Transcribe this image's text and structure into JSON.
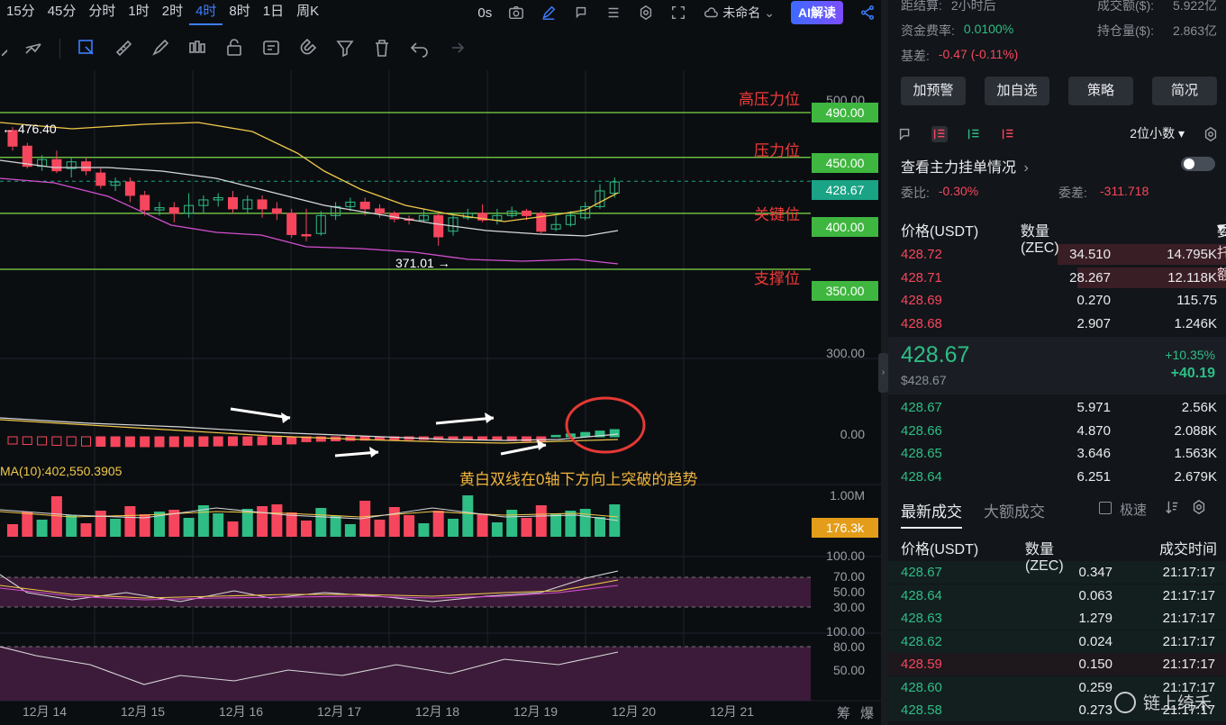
{
  "toolbar": {
    "timeframes": [
      "15分",
      "45分",
      "分时",
      "1时",
      "2时",
      "4时",
      "8时",
      "1日",
      "周K"
    ],
    "active_timeframe": "4时",
    "countdown": "0s",
    "layout_name": "未命名",
    "ai_label": "AI解读"
  },
  "chart": {
    "levels": [
      {
        "name": "高压力位",
        "value": "490.00"
      },
      {
        "name": "压力位",
        "value": "450.00"
      },
      {
        "name": "关键位",
        "value": "400.00"
      },
      {
        "name": "支撑位",
        "value": "350.00"
      }
    ],
    "last_price_tag": "428.67",
    "axis_labels": {
      "p500": "500.00",
      "p300": "300.00",
      "macd_zero": "0.00",
      "vol_max": "1.00M",
      "vol_tag": "176.3k"
    },
    "rsi_axis": [
      "100.00",
      "70.00",
      "50.00",
      "30.00"
    ],
    "kdj_axis": [
      "100.00",
      "80.00",
      "50.00"
    ],
    "high_note": "← 476.40",
    "low_note": "371.01 →",
    "ma_text": "MA(10):402,550.3905",
    "annotation": "黄白双线在0轴下方向上突破的趋势",
    "x_labels": [
      "12月 14",
      "12月 15",
      "12月 16",
      "12月 17",
      "12月 18",
      "12月 19",
      "12月 20",
      "12月 21"
    ],
    "corner_tags": [
      "筹",
      "爆"
    ],
    "colors": {
      "up": "#2ebd85",
      "down": "#f6465d",
      "level_line": "#7ddc4a",
      "ma_yellow": "#f0c84a",
      "ma_white": "#d8d8d8",
      "ma_pink": "#d44fd0"
    }
  },
  "panel": {
    "settle_label": "距结算:",
    "settle_value": "2小时后",
    "turnover_label": "成交额($):",
    "turnover_value": "5.922亿",
    "funding_label": "资金费率:",
    "funding_value": "0.0100%",
    "oi_label": "持仓量($):",
    "oi_value": "2.863亿",
    "basis_label": "基差:",
    "basis_value": "-0.47 (-0.11%)",
    "buttons": [
      "加预警",
      "加自选",
      "策略",
      "简况"
    ],
    "decimals": "2位小数",
    "main_orders": "查看主力挂单情况",
    "ratio_label": "委比:",
    "ratio_value": "-0.30%",
    "diff_label": "委差:",
    "diff_value": "-311.718",
    "ob_headers": [
      "价格(USDT)",
      "数量 (ZEC)",
      "委托额"
    ],
    "asks": [
      {
        "price": "428.72",
        "qty": "34.510",
        "amt": "14.795K",
        "depth": 0.5
      },
      {
        "price": "428.71",
        "qty": "28.267",
        "amt": "12.118K",
        "depth": 0.44
      },
      {
        "price": "428.69",
        "qty": "0.270",
        "amt": "115.75",
        "depth": 0
      },
      {
        "price": "428.68",
        "qty": "2.907",
        "amt": "1.246K",
        "depth": 0
      }
    ],
    "last_price": "428.67",
    "last_price_usd": "$428.67",
    "change_pct": "+10.35%",
    "change_abs": "+40.19",
    "bids": [
      {
        "price": "428.67",
        "qty": "5.971",
        "amt": "2.56K"
      },
      {
        "price": "428.66",
        "qty": "4.870",
        "amt": "2.088K"
      },
      {
        "price": "428.65",
        "qty": "3.646",
        "amt": "1.563K"
      },
      {
        "price": "428.64",
        "qty": "6.251",
        "amt": "2.679K"
      }
    ],
    "trade_tabs": [
      "最新成交",
      "大额成交"
    ],
    "fast_label": "极速",
    "trade_headers": [
      "价格(USDT)",
      "数量(ZEC)",
      "成交时间"
    ],
    "trades": [
      {
        "price": "428.67",
        "qty": "0.347",
        "time": "21:17:17",
        "side": "buy"
      },
      {
        "price": "428.64",
        "qty": "0.063",
        "time": "21:17:17",
        "side": "buy"
      },
      {
        "price": "428.63",
        "qty": "1.279",
        "time": "21:17:17",
        "side": "buy"
      },
      {
        "price": "428.62",
        "qty": "0.024",
        "time": "21:17:17",
        "side": "buy"
      },
      {
        "price": "428.59",
        "qty": "0.150",
        "time": "21:17:17",
        "side": "sell"
      },
      {
        "price": "428.60",
        "qty": "0.259",
        "time": "21:17:17",
        "side": "buy"
      },
      {
        "price": "428.58",
        "qty": "0.273",
        "time": "21:17:17",
        "side": "buy"
      }
    ],
    "watermark": "链上绮禾"
  }
}
